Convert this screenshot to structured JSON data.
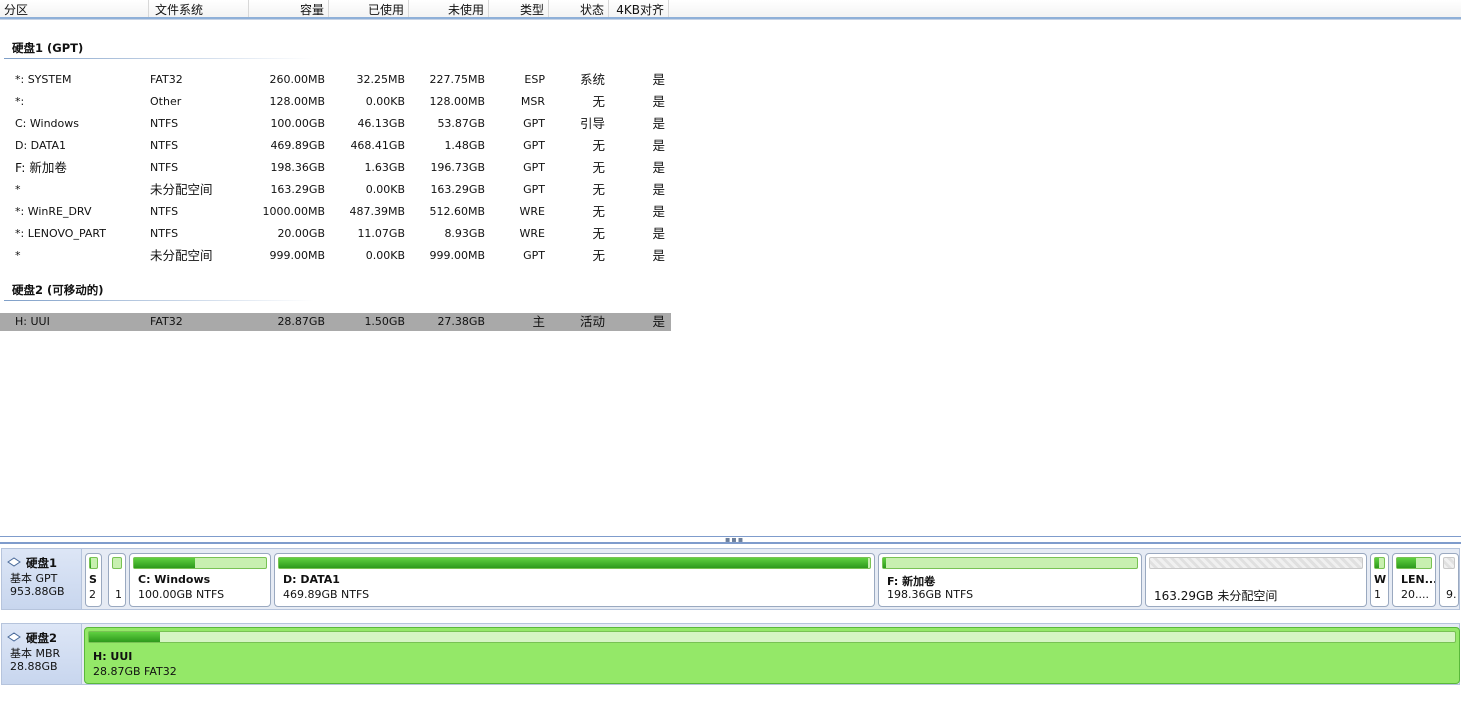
{
  "columns": {
    "partition": "分区",
    "filesystem": "文件系统",
    "capacity": "容量",
    "used": "已使用",
    "unused": "未使用",
    "type": "类型",
    "status": "状态",
    "align4k": "4KB对齐"
  },
  "disk1": {
    "title": "硬盘1 (GPT)",
    "rows": [
      {
        "name": "*: SYSTEM",
        "fs": "FAT32",
        "cap": "260.00MB",
        "used": "32.25MB",
        "free": "227.75MB",
        "type": "ESP",
        "status": "系统",
        "align": "是"
      },
      {
        "name": "*:",
        "fs": "Other",
        "cap": "128.00MB",
        "used": "0.00KB",
        "free": "128.00MB",
        "type": "MSR",
        "status": "无",
        "align": "是"
      },
      {
        "name": "C: Windows",
        "fs": "NTFS",
        "cap": "100.00GB",
        "used": "46.13GB",
        "free": "53.87GB",
        "type": "GPT",
        "status": "引导",
        "align": "是"
      },
      {
        "name": "D: DATA1",
        "fs": "NTFS",
        "cap": "469.89GB",
        "used": "468.41GB",
        "free": "1.48GB",
        "type": "GPT",
        "status": "无",
        "align": "是"
      },
      {
        "name": "F: 新加卷",
        "fs": "NTFS",
        "cap": "198.36GB",
        "used": "1.63GB",
        "free": "196.73GB",
        "type": "GPT",
        "status": "无",
        "align": "是"
      },
      {
        "name": "*",
        "fs": "未分配空间",
        "cap": "163.29GB",
        "used": "0.00KB",
        "free": "163.29GB",
        "type": "GPT",
        "status": "无",
        "align": "是"
      },
      {
        "name": "*: WinRE_DRV",
        "fs": "NTFS",
        "cap": "1000.00MB",
        "used": "487.39MB",
        "free": "512.60MB",
        "type": "WRE",
        "status": "无",
        "align": "是"
      },
      {
        "name": "*: LENOVO_PART",
        "fs": "NTFS",
        "cap": "20.00GB",
        "used": "11.07GB",
        "free": "8.93GB",
        "type": "WRE",
        "status": "无",
        "align": "是"
      },
      {
        "name": "*",
        "fs": "未分配空间",
        "cap": "999.00MB",
        "used": "0.00KB",
        "free": "999.00MB",
        "type": "GPT",
        "status": "无",
        "align": "是"
      }
    ]
  },
  "disk2": {
    "title": "硬盘2 (可移动的)",
    "rows": [
      {
        "name": "H: UUI",
        "fs": "FAT32",
        "cap": "28.87GB",
        "used": "1.50GB",
        "free": "27.38GB",
        "type": "主",
        "status": "活动",
        "align": "是"
      }
    ]
  },
  "map": {
    "disk1": {
      "name": "硬盘1",
      "type": "基本 GPT",
      "size": "953.88GB",
      "parts": {
        "system": {
          "name": "S",
          "info": "2",
          "used_fraction": 0.12
        },
        "msr": {
          "name": "",
          "info": "1",
          "used_fraction": 0.0
        },
        "c": {
          "name": "C: Windows",
          "info": "100.00GB NTFS",
          "used_fraction": 0.46
        },
        "d": {
          "name": "D: DATA1",
          "info": "469.89GB NTFS",
          "used_fraction": 0.997
        },
        "f": {
          "name": "F: 新加卷",
          "info": "198.36GB NTFS",
          "used_fraction": 0.01
        },
        "unalloc1": {
          "name": "",
          "info": "163.29GB 未分配空间"
        },
        "winre": {
          "name": "W",
          "info": "1",
          "used_fraction": 0.49
        },
        "lenovo": {
          "name": "LEN...",
          "info": "20....",
          "used_fraction": 0.55
        },
        "unalloc2": {
          "name": "",
          "info": "9."
        }
      }
    },
    "disk2": {
      "name": "硬盘2",
      "type": "基本 MBR",
      "size": "28.88GB",
      "parts": {
        "h": {
          "name": "H: UUI",
          "info": "28.87GB FAT32",
          "used_fraction": 0.052
        }
      }
    }
  },
  "colors": {
    "header_line": "#8fb0d8",
    "selected_row": "#a9a9a9",
    "used_fill": "#2e9a1c",
    "selected_partition": "#94e868"
  }
}
